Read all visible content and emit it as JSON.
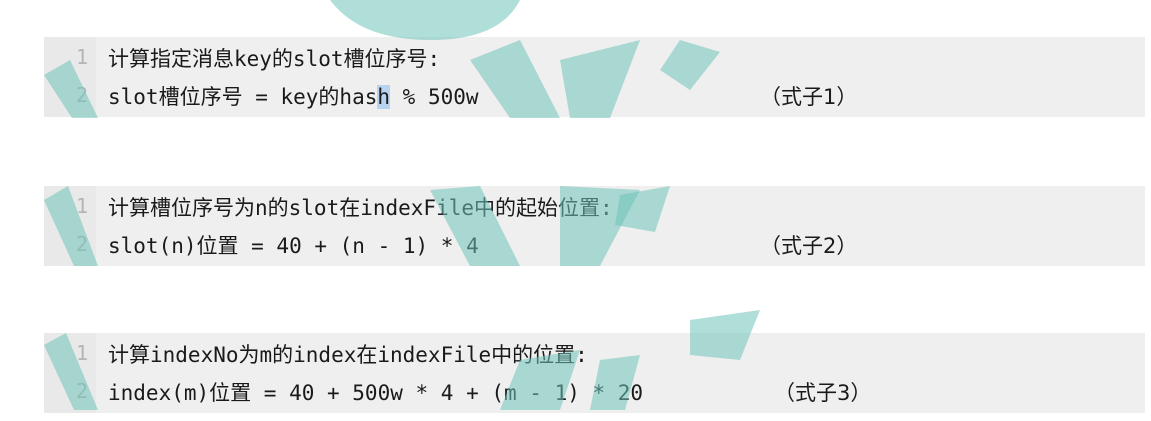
{
  "blocks": [
    {
      "lines": [
        {
          "number": "1",
          "text": "计算指定消息key的slot槽位序号:"
        },
        {
          "number": "2",
          "text_before": "slot槽位序号 = key的has",
          "selected": "h",
          "text_after": " % 500w",
          "tag": "（式子1）"
        }
      ]
    },
    {
      "lines": [
        {
          "number": "1",
          "text": "计算槽位序号为n的slot在indexFile中的起始位置:"
        },
        {
          "number": "2",
          "text": "slot(n)位置 = 40 + (n - 1) * 4",
          "tag": "（式子2）"
        }
      ]
    },
    {
      "lines": [
        {
          "number": "1",
          "text": "计算indexNo为m的index在indexFile中的位置:"
        },
        {
          "number": "2",
          "text": "index(m)位置 = 40 + 500w * 4 + (m - 1) * 20",
          "tag": "（式子3）"
        }
      ]
    }
  ],
  "colors": {
    "block_bg": "#efefef",
    "line_number": "#b5b5b5",
    "selection": "#b7d3f0",
    "watermark": "#6fc2b8"
  }
}
